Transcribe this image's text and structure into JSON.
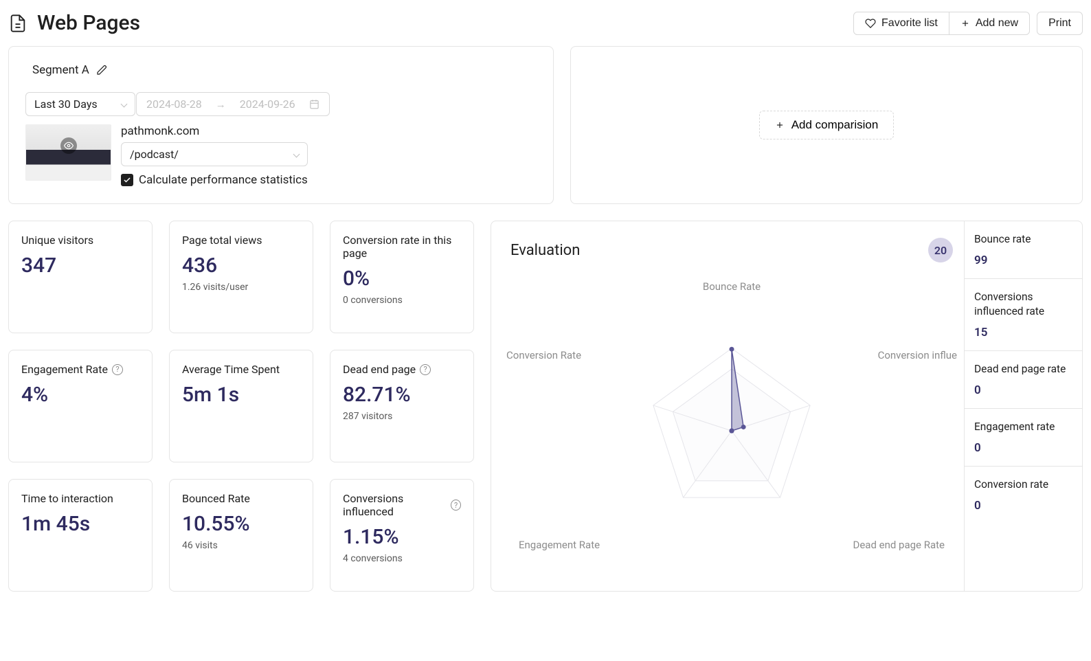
{
  "header": {
    "title": "Web Pages",
    "favorite_label": "Favorite list",
    "add_new_label": "Add new",
    "print_label": "Print"
  },
  "segment": {
    "name": "Segment A",
    "range_label": "Last 30 Days",
    "date_from": "2024-08-28",
    "date_to": "2024-09-26",
    "domain": "pathmonk.com",
    "page_path": "/podcast/",
    "checkbox_label": "Calculate performance statistics",
    "checkbox_checked": true
  },
  "compare": {
    "add_label": "Add comparision"
  },
  "metrics": [
    {
      "label": "Unique visitors",
      "value": "347",
      "sub": ""
    },
    {
      "label": "Page total views",
      "value": "436",
      "sub": "1.26 visits/user"
    },
    {
      "label": "Conversion rate in this page",
      "value": "0%",
      "sub": "0 conversions"
    },
    {
      "label": "Engagement Rate",
      "value": "4%",
      "sub": "",
      "help": true
    },
    {
      "label": "Average Time Spent",
      "value": "5m 1s",
      "sub": ""
    },
    {
      "label": "Dead end page",
      "value": "82.71%",
      "sub": "287 visitors",
      "help": true
    },
    {
      "label": "Time to interaction",
      "value": "1m 45s",
      "sub": ""
    },
    {
      "label": "Bounced Rate",
      "value": "10.55%",
      "sub": "46 visits"
    },
    {
      "label": "Conversions influenced",
      "value": "1.15%",
      "sub": "4 conversions",
      "help": true
    }
  ],
  "evaluation": {
    "title": "Evaluation",
    "score": "20",
    "axis_labels": {
      "top": "Bounce Rate",
      "right": "Conversion influe",
      "bottom_right": "Dead end page Rate",
      "bottom_left": "Engagement Rate",
      "left": "Conversion Rate"
    },
    "side": [
      {
        "label": "Bounce rate",
        "value": "99"
      },
      {
        "label": "Conversions influenced rate",
        "value": "15"
      },
      {
        "label": "Dead end page rate",
        "value": "0"
      },
      {
        "label": "Engagement rate",
        "value": "0"
      },
      {
        "label": "Conversion rate",
        "value": "0"
      }
    ]
  },
  "chart_data": {
    "type": "radar",
    "axes": [
      "Bounce Rate",
      "Conversion influenced",
      "Dead end page Rate",
      "Engagement Rate",
      "Conversion Rate"
    ],
    "values": [
      99,
      15,
      0,
      0,
      0
    ],
    "max": 100
  }
}
